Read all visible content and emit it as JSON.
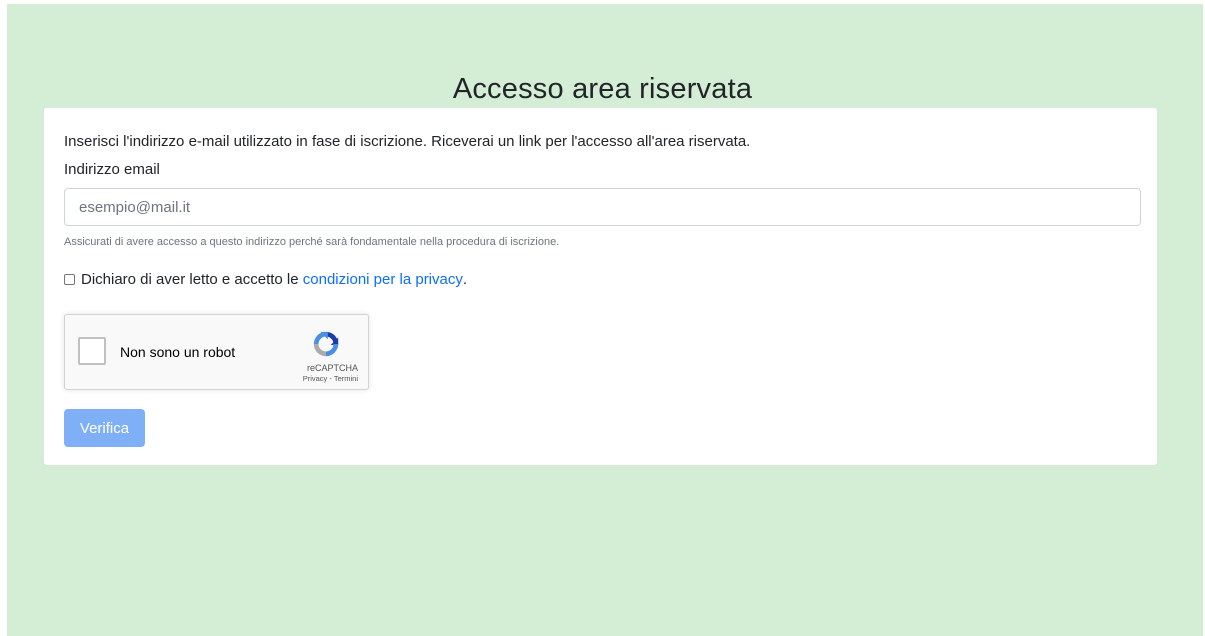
{
  "page": {
    "title": "Accesso area riservata",
    "background_color": "#d4edd5"
  },
  "form": {
    "intro_text": "Inserisci l'indirizzo e-mail utilizzato in fase di iscrizione. Riceverai un link per l'accesso all'area riservata.",
    "email_label": "Indirizzo email",
    "email_placeholder": "esempio@mail.it",
    "email_value": "",
    "email_help": "Assicurati di avere accesso a questo indirizzo perché sarà fondamentale nella procedura di iscrizione.",
    "privacy_prefix": "Dichiaro di aver letto e accetto le ",
    "privacy_link": "condizioni per la privacy",
    "privacy_suffix": ".",
    "privacy_checked": false,
    "submit_label": "Verifica",
    "submit_color": "#7fb0f7",
    "link_color": "#0d6efd"
  },
  "recaptcha": {
    "label": "Non sono un robot",
    "brand": "reCAPTCHA",
    "privacy_link": "Privacy",
    "separator": " - ",
    "terms_link": "Termini",
    "icon": "recaptcha-logo-icon"
  }
}
